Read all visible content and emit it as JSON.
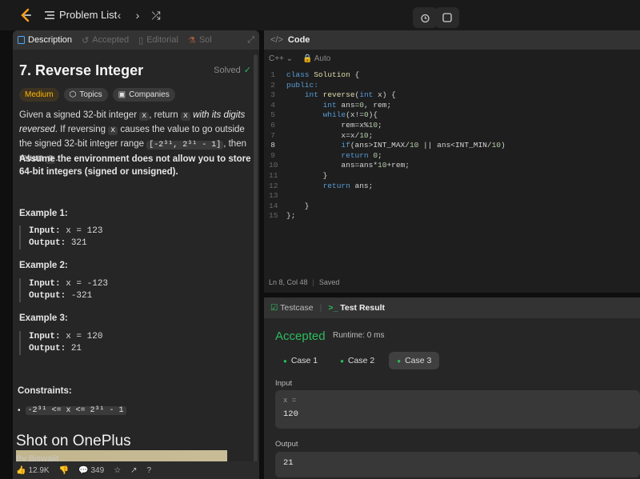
{
  "topbar": {
    "problem_list": "Problem List",
    "prev": "‹",
    "next": "›",
    "shuffle": "⤮"
  },
  "left": {
    "tabs": [
      {
        "label": "Description"
      },
      {
        "label": "Accepted"
      },
      {
        "label": "Editorial"
      },
      {
        "label": "Sol"
      }
    ],
    "title": "7. Reverse Integer",
    "solved": "Solved",
    "chips": {
      "difficulty": "Medium",
      "topics": "Topics",
      "companies": "Companies"
    },
    "desc": {
      "p1": "Given a signed 32-bit integer ",
      "c1": "x",
      "p2": ", return ",
      "c2": "x",
      "p3": " with its digits reversed",
      "p4": ". If reversing ",
      "c3": "x",
      "p5": " causes the value to go outside the signed 32-bit integer range ",
      "c4": "[-2³¹, 2³¹ - 1]",
      "p6": ", then return ",
      "c5": "0",
      "p7": "."
    },
    "assume": "Assume the environment does not allow you to store 64-bit integers (signed or unsigned).",
    "examples": [
      {
        "heading": "Example 1:",
        "input_label": "Input:",
        "input": "x = 123",
        "output_label": "Output:",
        "output": "321"
      },
      {
        "heading": "Example 2:",
        "input_label": "Input:",
        "input": "x = -123",
        "output_label": "Output:",
        "output": "-321"
      },
      {
        "heading": "Example 3:",
        "input_label": "Input:",
        "input": "x = 120",
        "output_label": "Output:",
        "output": "21"
      }
    ],
    "constraints_heading": "Constraints:",
    "constraint": "-2³¹ <= x <= 2³¹ - 1",
    "watermark": "Shot on OnePlus",
    "watermark_sub": "By Biswajit",
    "footer": {
      "likes": "12.9K",
      "comments": "349"
    }
  },
  "code": {
    "heading": "Code",
    "language": "C++",
    "auto": "Auto",
    "lines": [
      "class Solution {",
      "public:",
      "    int reverse(int x) {",
      "        int ans=0, rem;",
      "        while(x!=0){",
      "            rem=x%10;",
      "            x=x/10;",
      "            if(ans>INT_MAX/10 || ans<INT_MIN/10)",
      "            return 0;",
      "            ans=ans*10+rem;",
      "        }",
      "        return ans;",
      "",
      "    }",
      "};"
    ],
    "status_pos": "Ln 8, Col 48",
    "status_saved": "Saved"
  },
  "test": {
    "tab_testcase": "Testcase",
    "tab_result": "Test Result",
    "verdict": "Accepted",
    "runtime": "Runtime: 0 ms",
    "cases": [
      "Case 1",
      "Case 2",
      "Case 3"
    ],
    "input_label": "Input",
    "input_key": "x =",
    "input_value": "120",
    "output_label": "Output",
    "output_value": "21"
  },
  "colors": {
    "accepted": "#2cbb5d",
    "medium": "#ffb800",
    "panel": "#262626"
  }
}
